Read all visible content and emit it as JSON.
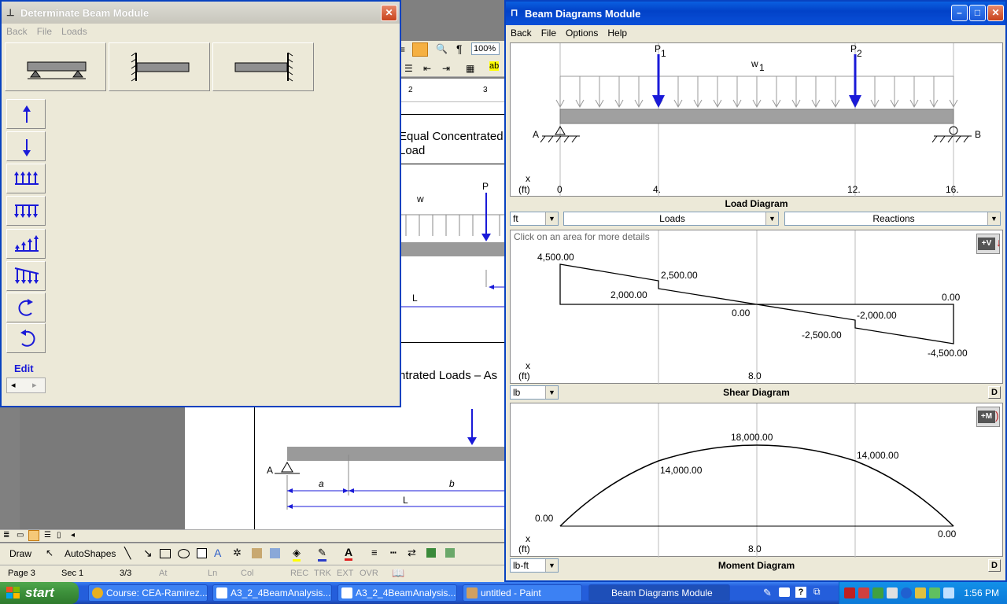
{
  "word": {
    "zoom": "100%",
    "ruler_marks": [
      "2",
      "3"
    ],
    "doc_heading_1_line1": "Equal Concentrated",
    "doc_heading_1_line2": "Load",
    "doc_label_w": "w",
    "doc_label_P": "P",
    "doc_label_L1": "L",
    "doc_heading_2": "ntrated Loads – As",
    "doc_label_A": "A",
    "doc_label_a": "a",
    "doc_label_b": "b",
    "doc_label_L2": "L",
    "draw_label": "Draw",
    "autoshapes_label": "AutoShapes",
    "status": {
      "page": "Page 3",
      "sec": "Sec 1",
      "pages": "3/3",
      "at": "At",
      "ln": "Ln",
      "col": "Col",
      "rec": "REC",
      "trk": "TRK",
      "ext": "EXT",
      "ovr": "OVR"
    }
  },
  "dbm": {
    "title": "Determinate Beam Module",
    "menu": [
      "Back",
      "File",
      "Loads"
    ],
    "edit_label": "Edit"
  },
  "bdm": {
    "title": "Beam Diagrams Module",
    "menu": [
      "Back",
      "File",
      "Options",
      "Help"
    ],
    "load": {
      "p1_label": "P",
      "p1_sub": "1",
      "p2_label": "P",
      "p2_sub": "2",
      "w1_label": "w",
      "w1_sub": "1",
      "support_a": "A",
      "support_b": "B",
      "x_label": "x",
      "x_unit": "(ft)",
      "ticks": [
        "0",
        "4.",
        "12.",
        "16."
      ],
      "diagram_label": "Load Diagram",
      "unit_value": "ft",
      "loads_value": "Loads",
      "reactions_value": "Reactions"
    },
    "shear": {
      "hint": "Click on an area for more details",
      "v_button": "+V",
      "values": [
        "4,500.00",
        "2,500.00",
        "2,000.00",
        "0.00",
        "0.00",
        "-2,000.00",
        "-2,500.00",
        "-4,500.00"
      ],
      "x_label": "x",
      "x_unit": "(ft)",
      "x_tick": "8.0",
      "unit_value": "lb",
      "diagram_label": "Shear Diagram",
      "d_button": "D"
    },
    "moment": {
      "m_button": "+M",
      "values": [
        "18,000.00",
        "14,000.00",
        "14,000.00",
        "0.00",
        "0.00"
      ],
      "x_label": "x",
      "x_unit": "(ft)",
      "x_tick": "8.0",
      "unit_value": "lb-ft",
      "diagram_label": "Moment Diagram",
      "d_button": "D"
    }
  },
  "taskbar": {
    "start": "start",
    "items": [
      {
        "label": "Course: CEA-Ramirez..."
      },
      {
        "label": "A3_2_4BeamAnalysis..."
      },
      {
        "label": "A3_2_4BeamAnalysis..."
      },
      {
        "label": "untitled - Paint"
      },
      {
        "label": "Beam Diagrams Module"
      }
    ],
    "clock": "1:56 PM"
  },
  "colors": {
    "xp_blue": "#0842c0",
    "arrow_blue": "#1a1ad8",
    "chrome": "#ece9d8",
    "beam_gray": "#a0a0a0"
  }
}
